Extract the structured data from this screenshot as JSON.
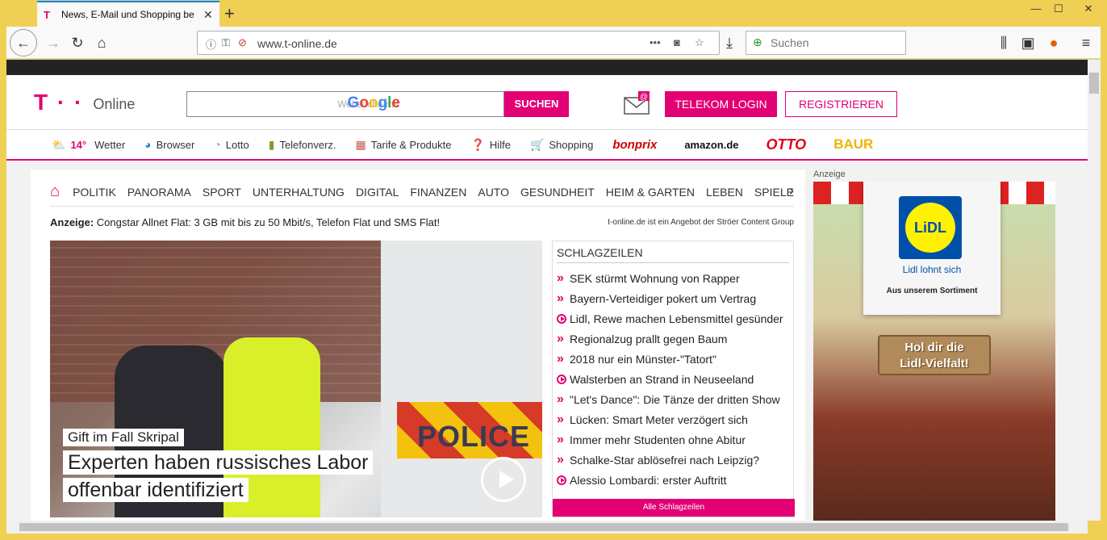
{
  "browser": {
    "tab_title": "News, E-Mail und Shopping be",
    "url": "www.t-online.de",
    "search_placeholder": "Suchen"
  },
  "header": {
    "brand_mark": "T · ·",
    "brand_text": "Online",
    "search_label": "Websuche mit",
    "search_logo": "Google",
    "search_button": "SUCHEN",
    "login_button": "TELEKOM LOGIN",
    "register_button": "REGISTRIEREN"
  },
  "servicebar": {
    "temperature": "14°",
    "items": [
      "Wetter",
      "Browser",
      "Lotto",
      "Telefonverz.",
      "Tarife & Produkte",
      "Hilfe",
      "Shopping"
    ],
    "shops": [
      "bonprix",
      "amazon.de",
      "OTTO",
      "BAUR"
    ]
  },
  "mainnav": {
    "items": [
      "POLITIK",
      "PANORAMA",
      "SPORT",
      "UNTERHALTUNG",
      "DIGITAL",
      "FINANZEN",
      "AUTO",
      "GESUNDHEIT",
      "HEIM & GARTEN",
      "LEBEN",
      "SPIELE"
    ]
  },
  "adline": {
    "label": "Anzeige:",
    "text": "Congstar Allnet Flat: 3 GB mit bis zu 50 Mbit/s, Telefon Flat und SMS Flat!",
    "right": "t-online.de ist ein Angebot der Ströer Content Group"
  },
  "hero": {
    "kicker": "Gift im Fall Skripal",
    "headline": "Experten haben russisches Labor offenbar identifiziert",
    "image_text": "POLICE"
  },
  "schlagzeilen": {
    "title": "SCHLAGZEILEN",
    "items": [
      {
        "text": "SEK stürmt Wohnung von Rapper",
        "video": false
      },
      {
        "text": "Bayern-Verteidiger pokert um Vertrag",
        "video": false
      },
      {
        "text": "Lidl, Rewe machen Lebensmittel gesünder",
        "video": true
      },
      {
        "text": "Regionalzug prallt gegen Baum",
        "video": false
      },
      {
        "text": "2018 nur ein Münster-\"Tatort\"",
        "video": false
      },
      {
        "text": "Walsterben an Strand in Neuseeland",
        "video": true
      },
      {
        "text": "\"Let's Dance\": Die Tänze der dritten Show",
        "video": false
      },
      {
        "text": "Lücken: Smart Meter verzögert sich",
        "video": false
      },
      {
        "text": "Immer mehr Studenten ohne Abitur",
        "video": false
      },
      {
        "text": "Schalke-Star ablösefrei nach Leipzig?",
        "video": false
      },
      {
        "text": "Alessio Lombardi: erster Auftritt",
        "video": true
      }
    ],
    "all_button": "Alle Schlagzeilen"
  },
  "ad": {
    "label": "Anzeige",
    "logo_text": "LiDL",
    "slogan": "Lidl lohnt sich",
    "sortiment": "Aus unserem Sortiment",
    "sign_line1": "Hol dir die",
    "sign_line2": "Lidl-Vielfalt!"
  },
  "colors": {
    "brand": "#e20074",
    "chrome": "#f0d054"
  }
}
